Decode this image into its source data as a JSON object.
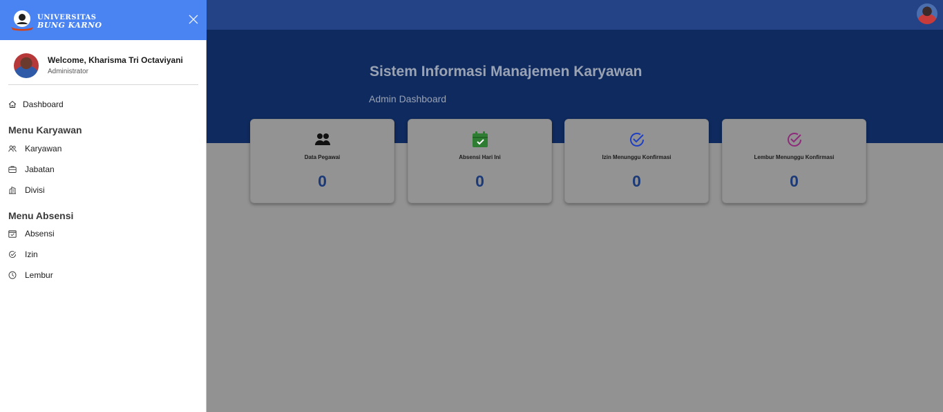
{
  "topbar": {
    "avatar_alt": "User avatar"
  },
  "hero": {
    "title": "Sistem Informasi Manajemen Karyawan",
    "subtitle": "Admin Dashboard"
  },
  "cards": [
    {
      "label": "Data Pegawai",
      "value": "0",
      "icon": "people-icon",
      "color": "#111111"
    },
    {
      "label": "Absensi Hari Ini",
      "value": "0",
      "icon": "calendar-check-icon",
      "color": "#2e7d32"
    },
    {
      "label": "Izin Menunggu Konfirmasi",
      "value": "0",
      "icon": "check-circle-icon",
      "color": "#1f3fc2"
    },
    {
      "label": "Lembur Menunggu Konfirmasi",
      "value": "0",
      "icon": "check-circle-icon",
      "color": "#8e2a7a"
    }
  ],
  "sidebar": {
    "logo_line1": "UNIVERSITAS",
    "logo_line2": "BUNG KARNO",
    "user": {
      "welcome": "Welcome, Kharisma Tri Octaviyani",
      "role": "Administrator"
    },
    "dashboard": {
      "label": "Dashboard",
      "icon": "home-icon"
    },
    "section_karyawan": "Menu Karyawan",
    "karyawan_items": [
      {
        "label": "Karyawan",
        "icon": "users-icon"
      },
      {
        "label": "Jabatan",
        "icon": "briefcase-icon"
      },
      {
        "label": "Divisi",
        "icon": "building-icon"
      }
    ],
    "section_absensi": "Menu Absensi",
    "absensi_items": [
      {
        "label": "Absensi",
        "icon": "calendar-check-icon"
      },
      {
        "label": "Izin",
        "icon": "check-circle-icon"
      },
      {
        "label": "Lembur",
        "icon": "clock-icon"
      }
    ]
  },
  "colors": {
    "sidebar_header": "#4a84f2",
    "topbar": "#244286",
    "hero": "#0f2a5e",
    "overlay": "#929292",
    "card_value": "#1b3a77"
  }
}
